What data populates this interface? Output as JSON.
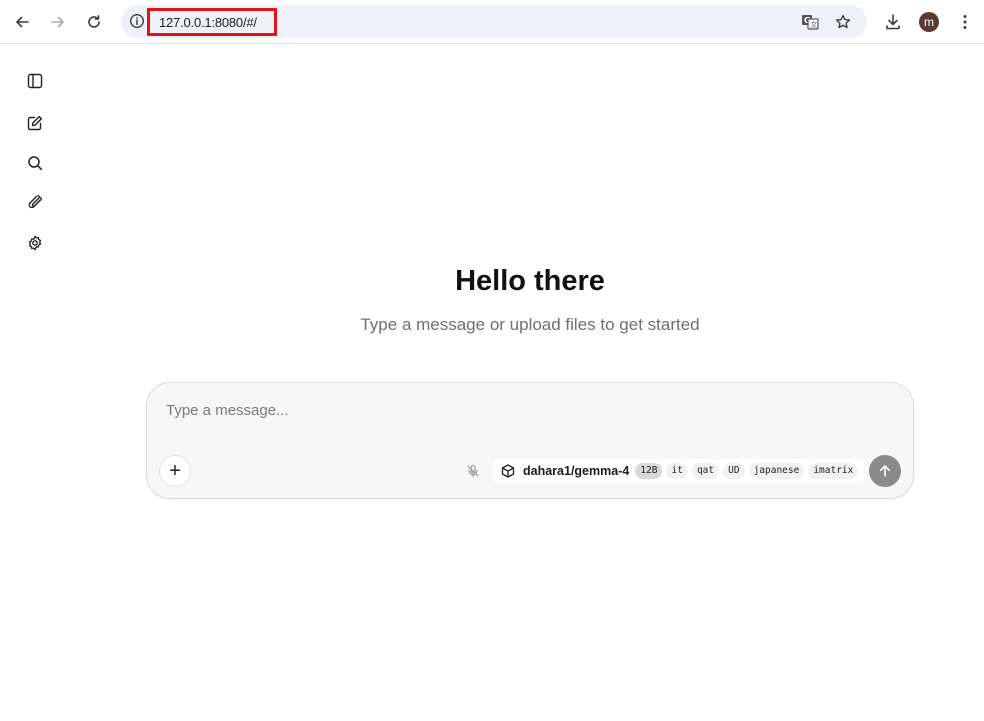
{
  "browser": {
    "url": "127.0.0.1:8080/#/",
    "profile_initial": "m",
    "icons": [
      "back-icon",
      "forward-icon",
      "reload-icon",
      "info-icon",
      "translate-icon",
      "star-icon",
      "download-icon",
      "menu-icon"
    ]
  },
  "sidebar": {
    "items": [
      {
        "name": "sidebar-toggle",
        "icon": "panel-left-icon"
      },
      {
        "name": "new-chat",
        "icon": "edit-icon"
      },
      {
        "name": "search",
        "icon": "search-icon"
      },
      {
        "name": "attachments",
        "icon": "paperclip-icon"
      },
      {
        "name": "settings",
        "icon": "gear-icon"
      }
    ]
  },
  "main": {
    "greeting": "Hello there",
    "subtitle": "Type a message or upload files to get started"
  },
  "composer": {
    "placeholder": "Type a message...",
    "add_label": "+",
    "model": {
      "name": "dahara1/gemma-4",
      "tags": [
        "12B",
        "it",
        "qat",
        "UD",
        "japanese",
        "imatrix"
      ]
    }
  },
  "colors": {
    "url_highlight": "#e0131b",
    "avatar_bg": "#5b3a31",
    "send_button": "#8a8a8a"
  }
}
